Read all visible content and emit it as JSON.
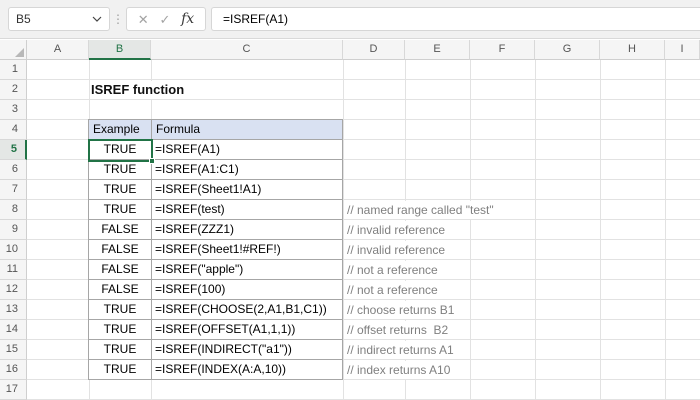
{
  "formula_bar": {
    "cell_reference": "B5",
    "formula": "=ISREF(A1)",
    "cancel_label": "✕",
    "enter_label": "✓",
    "fx_label": "fx",
    "dots": "⋮"
  },
  "grid": {
    "column_headers": [
      "A",
      "B",
      "C",
      "D",
      "E",
      "F",
      "G",
      "H",
      "I"
    ],
    "row_headers": [
      "1",
      "2",
      "3",
      "4",
      "5",
      "6",
      "7",
      "8",
      "9",
      "10",
      "11",
      "12",
      "13",
      "14",
      "15",
      "16",
      "17"
    ],
    "selected_column": "B",
    "selected_row": "5",
    "selected_cell": "B5"
  },
  "sheet": {
    "title": "ISREF function",
    "table": {
      "headers": [
        "Example",
        "Formula"
      ],
      "rows": [
        {
          "example": "TRUE",
          "formula": "=ISREF(A1)",
          "comment": ""
        },
        {
          "example": "TRUE",
          "formula": "=ISREF(A1:C1)",
          "comment": ""
        },
        {
          "example": "TRUE",
          "formula": "=ISREF(Sheet1!A1)",
          "comment": ""
        },
        {
          "example": "TRUE",
          "formula": "=ISREF(test)",
          "comment": "// named range called \"test\""
        },
        {
          "example": "FALSE",
          "formula": "=ISREF(ZZZ1)",
          "comment": "// invalid reference"
        },
        {
          "example": "FALSE",
          "formula": "=ISREF(Sheet1!#REF!)",
          "comment": "// invalid reference"
        },
        {
          "example": "FALSE",
          "formula": "=ISREF(\"apple\")",
          "comment": "// not a reference"
        },
        {
          "example": "FALSE",
          "formula": "=ISREF(100)",
          "comment": "// not a reference"
        },
        {
          "example": "TRUE",
          "formula": "=ISREF(CHOOSE(2,A1,B1,C1))",
          "comment": "// choose returns B1"
        },
        {
          "example": "TRUE",
          "formula": "=ISREF(OFFSET(A1,1,1))",
          "comment": "// offset returns  B2"
        },
        {
          "example": "TRUE",
          "formula": "=ISREF(INDIRECT(\"a1\"))",
          "comment": "// indirect returns A1"
        },
        {
          "example": "TRUE",
          "formula": "=ISREF(INDEX(A:A,10))",
          "comment": "// index returns A10"
        }
      ]
    }
  },
  "colors": {
    "accent_green": "#217346",
    "table_header_fill": "#D9E1F2",
    "table_border": "#A6A6A6",
    "comment_text": "#7F7F7F",
    "header_fill": "#F5F5F5",
    "selected_header_fill": "#E4E7E5",
    "gridline": "#E2E2E2",
    "formula_bar_bg": "#F1F1F1"
  }
}
